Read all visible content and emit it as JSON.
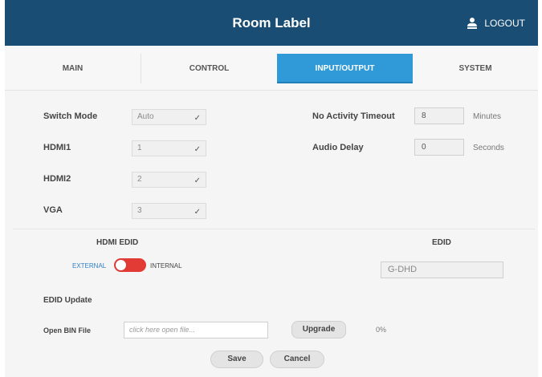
{
  "header": {
    "title": "Room Label",
    "logout_label": "LOGOUT"
  },
  "tabs": [
    {
      "label": "MAIN"
    },
    {
      "label": "CONTROL"
    },
    {
      "label": "INPUT/OUTPUT",
      "active": true
    },
    {
      "label": "SYSTEM"
    }
  ],
  "io": {
    "switch_mode": {
      "label": "Switch Mode",
      "value": "Auto"
    },
    "hdmi1": {
      "label": "HDMI1",
      "value": "1"
    },
    "hdmi2": {
      "label": "HDMI2",
      "value": "2"
    },
    "vga": {
      "label": "VGA",
      "value": "3"
    },
    "no_activity_timeout": {
      "label": "No Activity Timeout",
      "value": "8",
      "unit": "Minutes"
    },
    "audio_delay": {
      "label": "Audio Delay",
      "value": "0",
      "unit": "Seconds"
    }
  },
  "hdmi_edid": {
    "title": "HDMI EDID",
    "left_label": "EXTERNAL",
    "right_label": "INTERNAL",
    "toggle_state": "EXTERNAL"
  },
  "edid": {
    "title": "EDID",
    "value": "G-DHD"
  },
  "edid_update": {
    "title": "EDID Update",
    "file_label": "Open BIN File",
    "file_placeholder": "click here open file...",
    "upgrade_label": "Upgrade",
    "progress": "0%"
  },
  "actions": {
    "save_label": "Save",
    "cancel_label": "Cancel"
  },
  "colors": {
    "header": "#1a4d74",
    "active_tab": "#2f9ad7",
    "toggle": "#e23b36"
  }
}
